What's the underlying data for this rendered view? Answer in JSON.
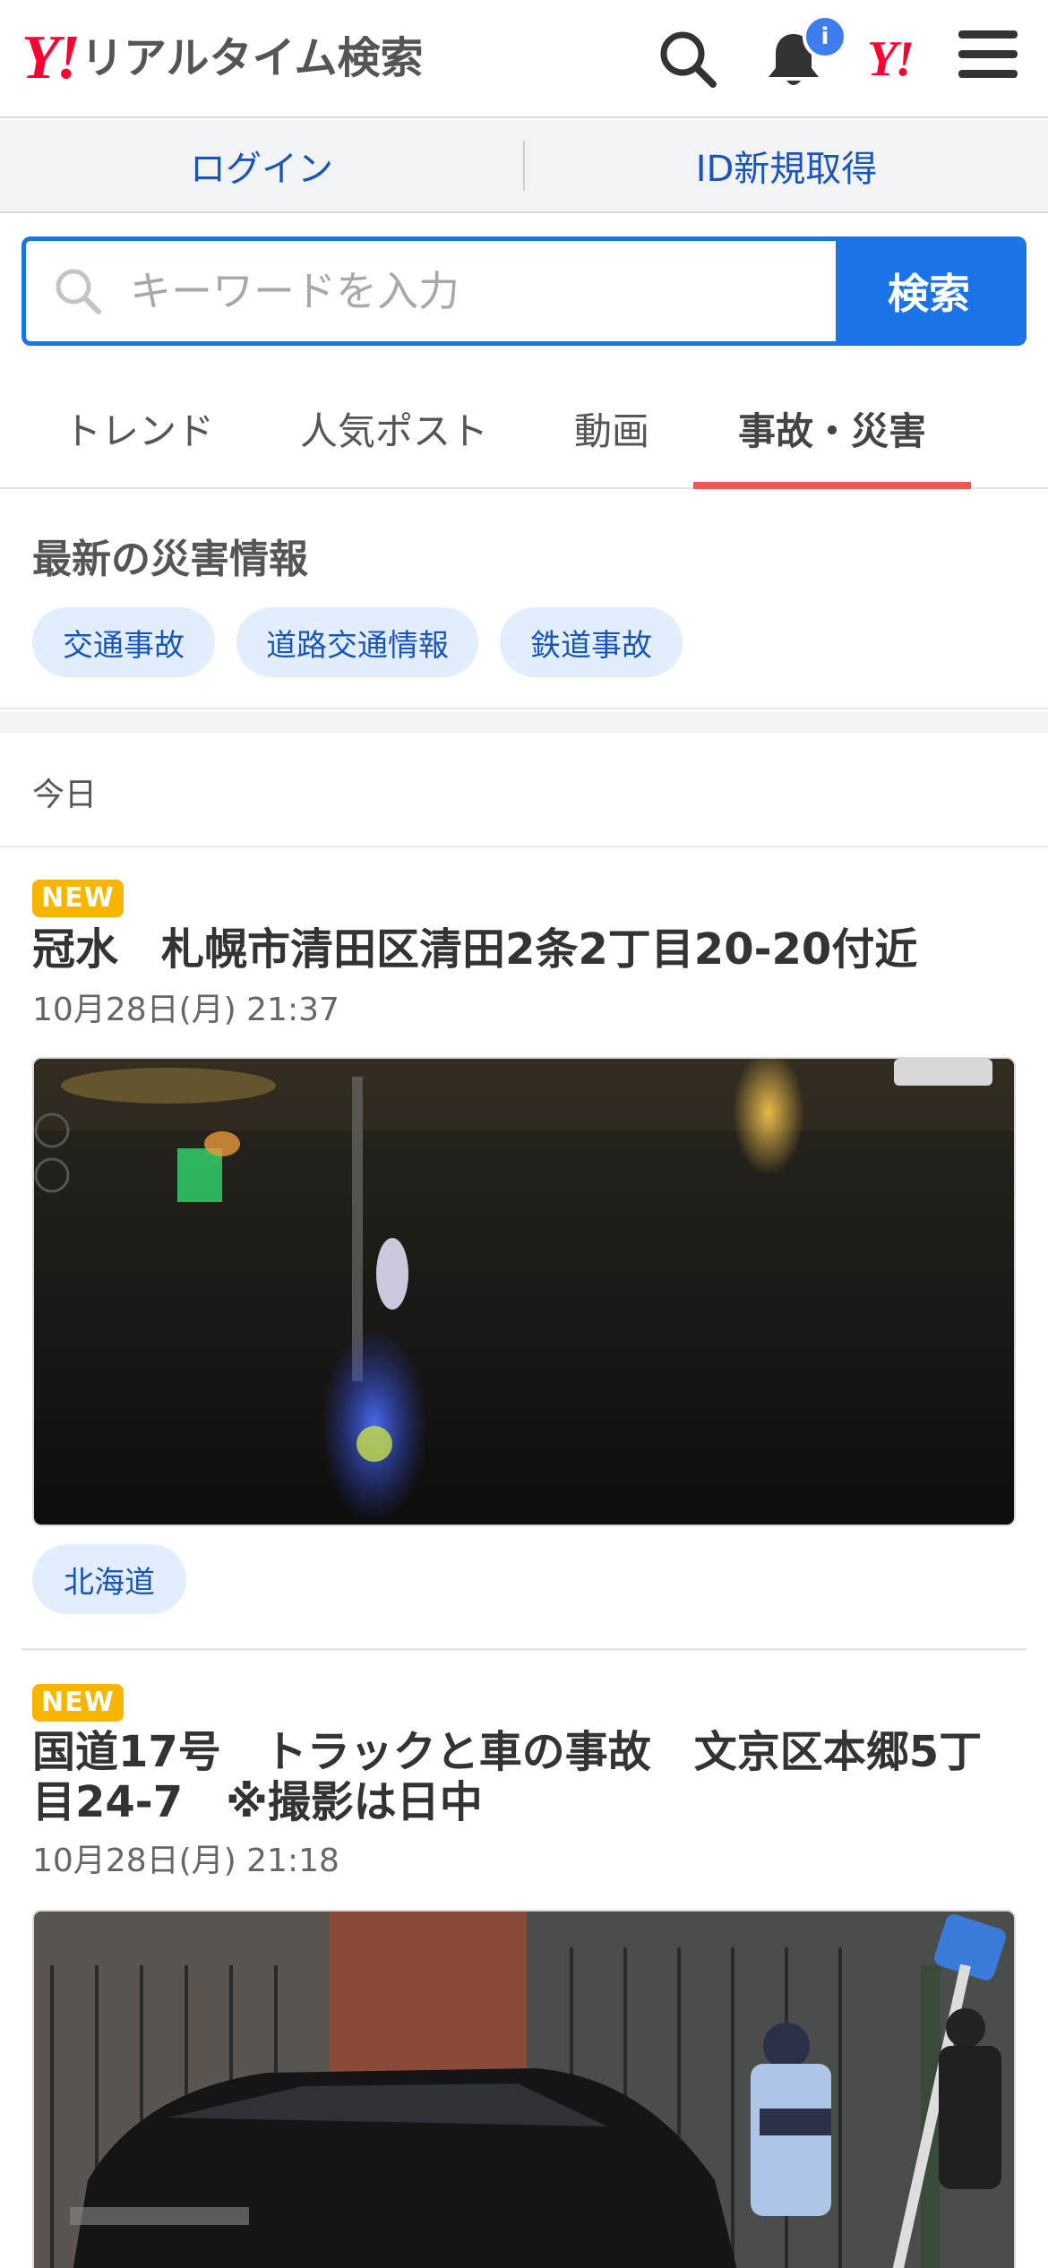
{
  "header": {
    "logo_y": "Y!",
    "logo_text": "リアルタイム検索",
    "notification_badge": "i",
    "yahoo_mark": "Y!",
    "icons": [
      "search-icon",
      "bell-icon",
      "menu-icon"
    ]
  },
  "account": {
    "login": "ログイン",
    "register": "ID新規取得"
  },
  "search": {
    "placeholder": "キーワードを入力",
    "button": "検索"
  },
  "tabs": [
    {
      "label": "トレンド",
      "active": false
    },
    {
      "label": "人気ポスト",
      "active": false
    },
    {
      "label": "動画",
      "active": false
    },
    {
      "label": "事故・災害",
      "active": true
    }
  ],
  "disaster": {
    "title": "最新の災害情報",
    "chips": [
      "交通事故",
      "道路交通情報",
      "鉄道事故"
    ]
  },
  "section_label": "今日",
  "posts": [
    {
      "badge": "NEW",
      "title": "冠水　札幌市清田区清田2条2丁目20-20付近",
      "date": "10月28日(月) 21:37",
      "tag": "北海道"
    },
    {
      "badge": "NEW",
      "title": "国道17号　トラックと車の事故　文京区本郷5丁目24-7　※撮影は日中",
      "date": "10月28日(月) 21:18"
    }
  ],
  "colors": {
    "accent_blue": "#1a74e8",
    "link_blue": "#1a56b8",
    "yahoo_red": "#ff0033",
    "active_tab_underline": "#e85a50",
    "new_badge": "#f8b500"
  }
}
